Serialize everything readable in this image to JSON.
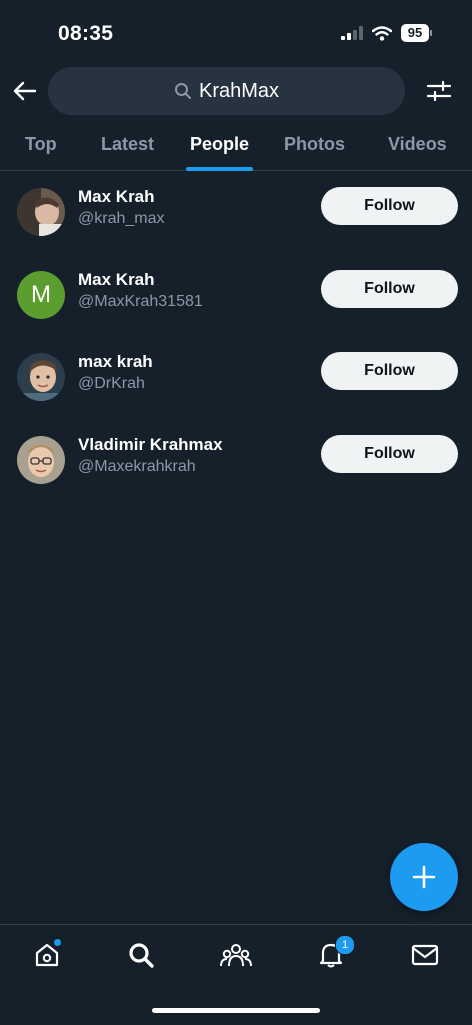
{
  "status_bar": {
    "time": "08:35",
    "battery": "95"
  },
  "search": {
    "query": "KrahMax"
  },
  "tabs": [
    {
      "label": "Top"
    },
    {
      "label": "Latest"
    },
    {
      "label": "People"
    },
    {
      "label": "Photos"
    },
    {
      "label": "Videos"
    }
  ],
  "active_tab": "People",
  "users": [
    {
      "name": "Max Krah",
      "handle": "@krah_max",
      "follow_label": "Follow",
      "avatar": "photo-avatar"
    },
    {
      "name": "Max Krah",
      "handle": "@MaxKrah31581",
      "follow_label": "Follow",
      "avatar_letter": "M",
      "avatar_color": "#5c9d30"
    },
    {
      "name": "max krah",
      "handle": "@DrKrah",
      "follow_label": "Follow",
      "avatar": "photo-avatar"
    },
    {
      "name": "Vladimir Krahmax",
      "handle": "@Maxekrahkrah",
      "follow_label": "Follow",
      "avatar": "photo-avatar"
    }
  ],
  "nav": {
    "items": [
      "home-icon",
      "search-icon",
      "communities-icon",
      "notifications-icon",
      "messages-icon"
    ],
    "notifications_badge": "1"
  },
  "colors": {
    "background": "#15202b",
    "accent": "#1d9bf0",
    "muted_text": "#8b98a5"
  }
}
